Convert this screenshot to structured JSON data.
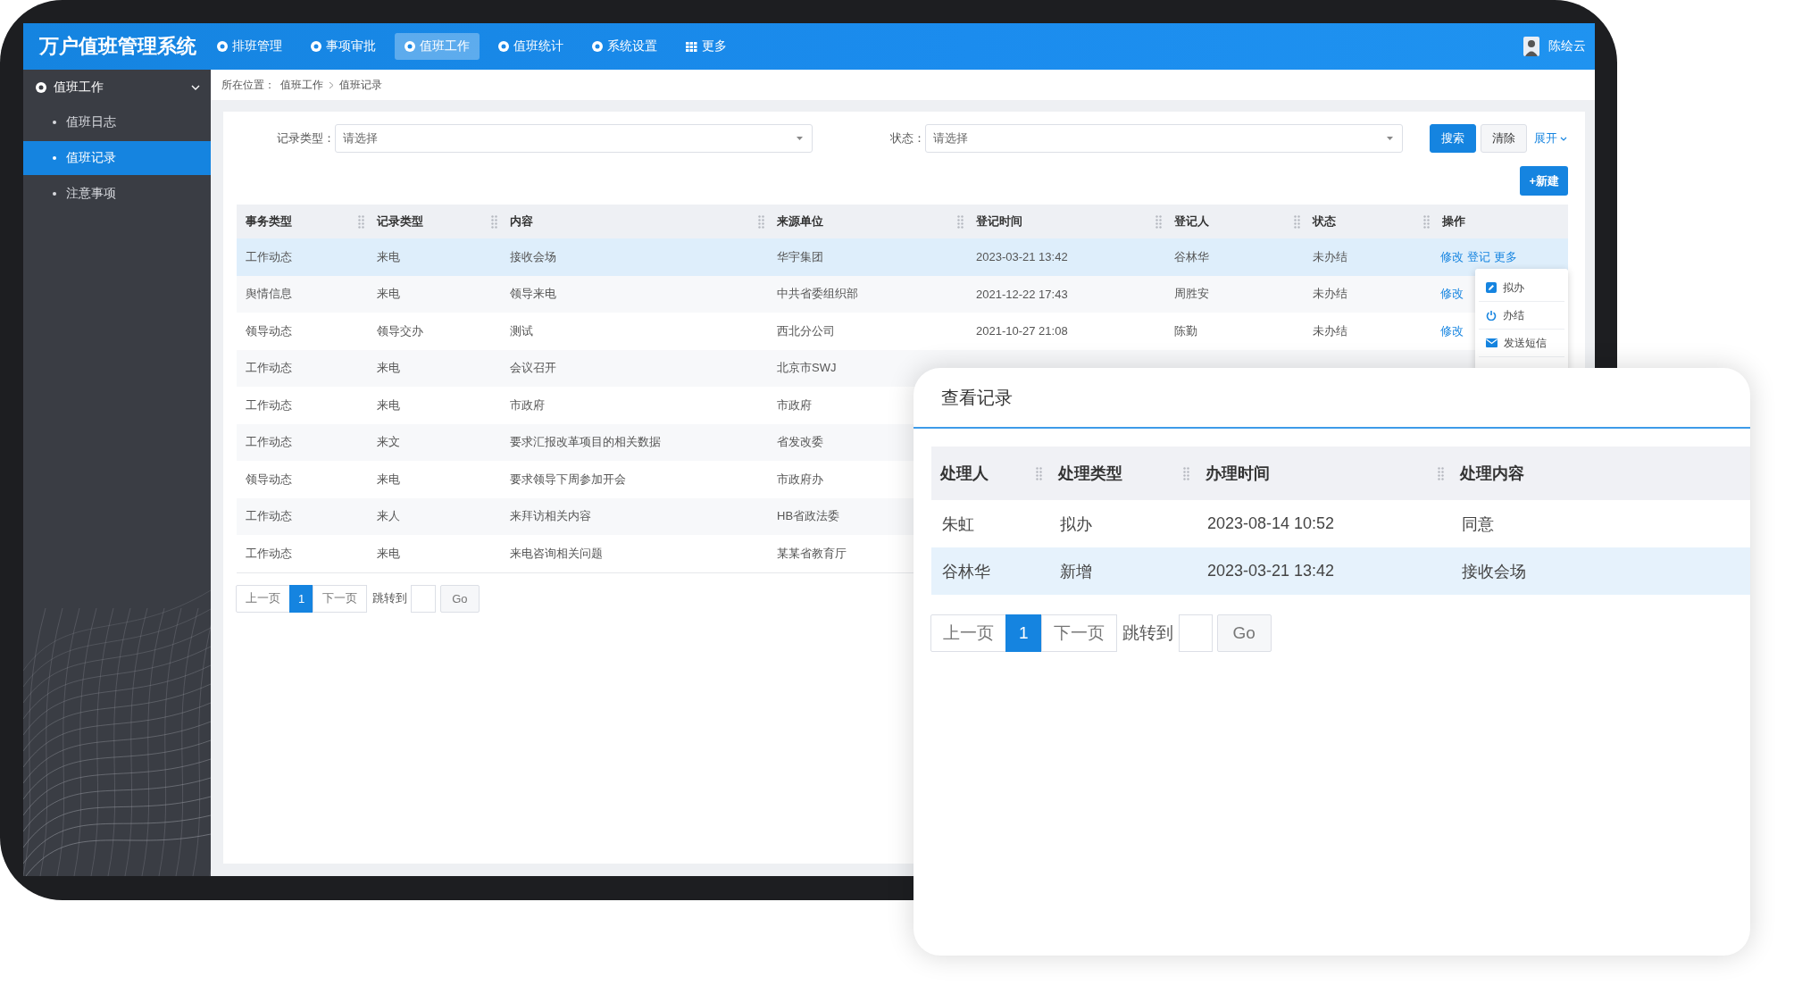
{
  "app": {
    "title": "万户值班管理系统",
    "user": "陈绘云"
  },
  "nav": [
    {
      "label": "排班管理",
      "kind": "dot",
      "selected": false
    },
    {
      "label": "事项审批",
      "kind": "dot",
      "selected": false
    },
    {
      "label": "值班工作",
      "kind": "dot",
      "selected": true
    },
    {
      "label": "值班统计",
      "kind": "dot",
      "selected": false
    },
    {
      "label": "系统设置",
      "kind": "dot",
      "selected": false
    },
    {
      "label": "更多",
      "kind": "grid",
      "selected": false
    }
  ],
  "sidebar": {
    "group": {
      "label": "值班工作",
      "expanded": true
    },
    "items": [
      {
        "label": "值班日志",
        "selected": false
      },
      {
        "label": "值班记录",
        "selected": true
      },
      {
        "label": "注意事项",
        "selected": false
      }
    ]
  },
  "breadcrumb": {
    "prefix": "所在位置：",
    "path": [
      "值班工作",
      "值班记录"
    ]
  },
  "filters": [
    {
      "label": "记录类型：",
      "placeholder": "请选择"
    },
    {
      "label": "状态：",
      "placeholder": "请选择"
    }
  ],
  "buttons": {
    "search": "搜索",
    "clear": "清除",
    "expand": "展开",
    "new": "+新建"
  },
  "table": {
    "columns": [
      "事务类型",
      "记录类型",
      "内容",
      "来源单位",
      "登记时间",
      "登记人",
      "状态",
      "操作"
    ],
    "rows": [
      {
        "cells": [
          "工作动态",
          "来电",
          "接收会场",
          "华宇集团",
          "2023-03-21 13:42",
          "谷林华",
          "未办结"
        ],
        "actions": [
          "修改",
          "登记",
          "更多"
        ],
        "selected": true
      },
      {
        "cells": [
          "舆情信息",
          "来电",
          "领导来电",
          "中共省委组织部",
          "2021-12-22 17:43",
          "周胜安",
          "未办结"
        ],
        "actions": [
          "修改"
        ],
        "selected": false
      },
      {
        "cells": [
          "领导动态",
          "领导交办",
          "测试",
          "西北分公司",
          "2021-10-27 21:08",
          "陈勤",
          "未办结"
        ],
        "actions": [
          "修改"
        ],
        "selected": false
      },
      {
        "cells": [
          "工作动态",
          "来电",
          "会议召开",
          "北京市SWJ"
        ],
        "selected": false
      },
      {
        "cells": [
          "工作动态",
          "来电",
          "市政府",
          "市政府"
        ],
        "selected": false
      },
      {
        "cells": [
          "工作动态",
          "来文",
          "要求汇报改革项目的相关数据",
          "省发改委"
        ],
        "selected": false
      },
      {
        "cells": [
          "领导动态",
          "来电",
          "要求领导下周参加开会",
          "市政府办"
        ],
        "selected": false
      },
      {
        "cells": [
          "工作动态",
          "来人",
          "来拜访相关内容",
          "HB省政法委"
        ],
        "selected": false
      },
      {
        "cells": [
          "工作动态",
          "来电",
          "来电咨询相关问题",
          "某某省教育厅"
        ],
        "selected": false
      }
    ]
  },
  "action_menu": {
    "items": [
      {
        "label": "拟办",
        "kind": "edit"
      },
      {
        "label": "办结",
        "kind": "power"
      },
      {
        "label": "发送短信",
        "kind": "mail"
      }
    ]
  },
  "pagination": {
    "prev": "上一页",
    "pages": [
      {
        "label": "1",
        "selected": true
      }
    ],
    "next": "下一页",
    "jump": "跳转到",
    "go": "Go"
  },
  "dialog": {
    "title": "查看记录",
    "columns": [
      "处理人",
      "处理类型",
      "办理时间",
      "处理内容"
    ],
    "rows": [
      {
        "cells": [
          "朱虹",
          "拟办",
          "2023-08-14 10:52",
          "同意"
        ],
        "selected": false
      },
      {
        "cells": [
          "谷林华",
          "新增",
          "2023-03-21 13:42",
          "接收会场"
        ],
        "selected": true
      }
    ],
    "pagination": {
      "prev": "上一页",
      "pages": [
        {
          "label": "1",
          "selected": true
        }
      ],
      "next": "下一页",
      "jump": "跳转到",
      "go": "Go"
    }
  }
}
